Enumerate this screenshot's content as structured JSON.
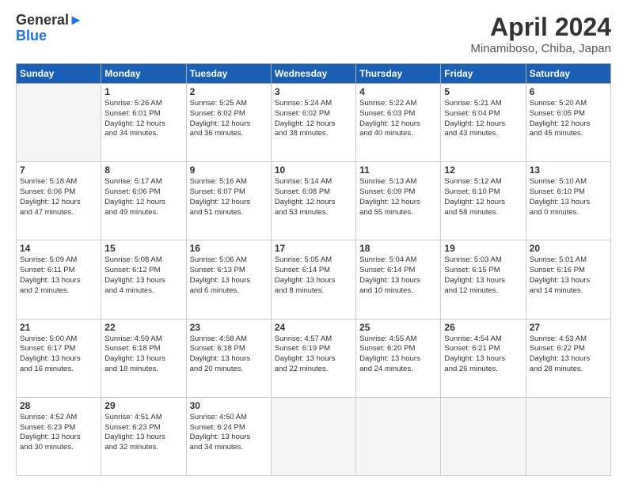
{
  "logo": {
    "line1": "General",
    "line2": "Blue",
    "icon": "▶"
  },
  "title": "April 2024",
  "subtitle": "Minamiboso, Chiba, Japan",
  "headers": [
    "Sunday",
    "Monday",
    "Tuesday",
    "Wednesday",
    "Thursday",
    "Friday",
    "Saturday"
  ],
  "weeks": [
    [
      {
        "day": "",
        "info": ""
      },
      {
        "day": "1",
        "info": "Sunrise: 5:26 AM\nSunset: 6:01 PM\nDaylight: 12 hours\nand 34 minutes."
      },
      {
        "day": "2",
        "info": "Sunrise: 5:25 AM\nSunset: 6:02 PM\nDaylight: 12 hours\nand 36 minutes."
      },
      {
        "day": "3",
        "info": "Sunrise: 5:24 AM\nSunset: 6:02 PM\nDaylight: 12 hours\nand 38 minutes."
      },
      {
        "day": "4",
        "info": "Sunrise: 5:22 AM\nSunset: 6:03 PM\nDaylight: 12 hours\nand 40 minutes."
      },
      {
        "day": "5",
        "info": "Sunrise: 5:21 AM\nSunset: 6:04 PM\nDaylight: 12 hours\nand 43 minutes."
      },
      {
        "day": "6",
        "info": "Sunrise: 5:20 AM\nSunset: 6:05 PM\nDaylight: 12 hours\nand 45 minutes."
      }
    ],
    [
      {
        "day": "7",
        "info": "Sunrise: 5:18 AM\nSunset: 6:06 PM\nDaylight: 12 hours\nand 47 minutes."
      },
      {
        "day": "8",
        "info": "Sunrise: 5:17 AM\nSunset: 6:06 PM\nDaylight: 12 hours\nand 49 minutes."
      },
      {
        "day": "9",
        "info": "Sunrise: 5:16 AM\nSunset: 6:07 PM\nDaylight: 12 hours\nand 51 minutes."
      },
      {
        "day": "10",
        "info": "Sunrise: 5:14 AM\nSunset: 6:08 PM\nDaylight: 12 hours\nand 53 minutes."
      },
      {
        "day": "11",
        "info": "Sunrise: 5:13 AM\nSunset: 6:09 PM\nDaylight: 12 hours\nand 55 minutes."
      },
      {
        "day": "12",
        "info": "Sunrise: 5:12 AM\nSunset: 6:10 PM\nDaylight: 12 hours\nand 58 minutes."
      },
      {
        "day": "13",
        "info": "Sunrise: 5:10 AM\nSunset: 6:10 PM\nDaylight: 13 hours\nand 0 minutes."
      }
    ],
    [
      {
        "day": "14",
        "info": "Sunrise: 5:09 AM\nSunset: 6:11 PM\nDaylight: 13 hours\nand 2 minutes."
      },
      {
        "day": "15",
        "info": "Sunrise: 5:08 AM\nSunset: 6:12 PM\nDaylight: 13 hours\nand 4 minutes."
      },
      {
        "day": "16",
        "info": "Sunrise: 5:06 AM\nSunset: 6:13 PM\nDaylight: 13 hours\nand 6 minutes."
      },
      {
        "day": "17",
        "info": "Sunrise: 5:05 AM\nSunset: 6:14 PM\nDaylight: 13 hours\nand 8 minutes."
      },
      {
        "day": "18",
        "info": "Sunrise: 5:04 AM\nSunset: 6:14 PM\nDaylight: 13 hours\nand 10 minutes."
      },
      {
        "day": "19",
        "info": "Sunrise: 5:03 AM\nSunset: 6:15 PM\nDaylight: 13 hours\nand 12 minutes."
      },
      {
        "day": "20",
        "info": "Sunrise: 5:01 AM\nSunset: 6:16 PM\nDaylight: 13 hours\nand 14 minutes."
      }
    ],
    [
      {
        "day": "21",
        "info": "Sunrise: 5:00 AM\nSunset: 6:17 PM\nDaylight: 13 hours\nand 16 minutes."
      },
      {
        "day": "22",
        "info": "Sunrise: 4:59 AM\nSunset: 6:18 PM\nDaylight: 13 hours\nand 18 minutes."
      },
      {
        "day": "23",
        "info": "Sunrise: 4:58 AM\nSunset: 6:18 PM\nDaylight: 13 hours\nand 20 minutes."
      },
      {
        "day": "24",
        "info": "Sunrise: 4:57 AM\nSunset: 6:19 PM\nDaylight: 13 hours\nand 22 minutes."
      },
      {
        "day": "25",
        "info": "Sunrise: 4:55 AM\nSunset: 6:20 PM\nDaylight: 13 hours\nand 24 minutes."
      },
      {
        "day": "26",
        "info": "Sunrise: 4:54 AM\nSunset: 6:21 PM\nDaylight: 13 hours\nand 26 minutes."
      },
      {
        "day": "27",
        "info": "Sunrise: 4:53 AM\nSunset: 6:22 PM\nDaylight: 13 hours\nand 28 minutes."
      }
    ],
    [
      {
        "day": "28",
        "info": "Sunrise: 4:52 AM\nSunset: 6:23 PM\nDaylight: 13 hours\nand 30 minutes."
      },
      {
        "day": "29",
        "info": "Sunrise: 4:51 AM\nSunset: 6:23 PM\nDaylight: 13 hours\nand 32 minutes."
      },
      {
        "day": "30",
        "info": "Sunrise: 4:50 AM\nSunset: 6:24 PM\nDaylight: 13 hours\nand 34 minutes."
      },
      {
        "day": "",
        "info": ""
      },
      {
        "day": "",
        "info": ""
      },
      {
        "day": "",
        "info": ""
      },
      {
        "day": "",
        "info": ""
      }
    ]
  ]
}
